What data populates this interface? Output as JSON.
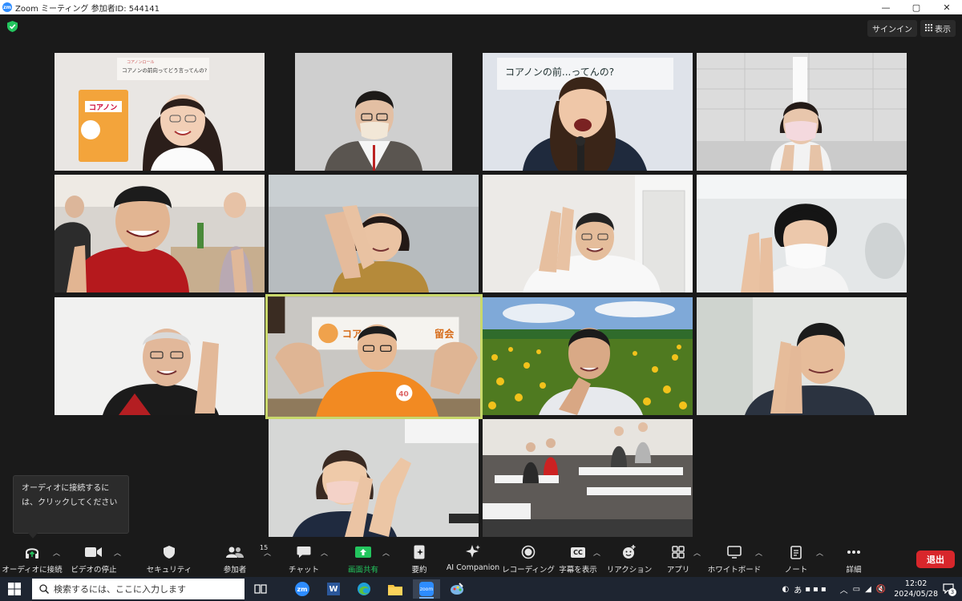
{
  "titlebar": {
    "app_badge": "zm",
    "title": "Zoom ミーティング 参加者ID: 544141",
    "minimize": "—",
    "maximize": "▢",
    "close": "✕"
  },
  "top_right": {
    "signin_label": "サインイン",
    "view_label": "表示"
  },
  "tiles": [
    {
      "id": "p1",
      "sign_text_1": "コアノンロール",
      "sign_text_2": "コアノンの前向ってどう言ってんの?",
      "product_label": "コアノン"
    },
    {
      "id": "p2"
    },
    {
      "id": "p3",
      "sign_text_1": "コアノンの前...ってんの?"
    },
    {
      "id": "p4"
    },
    {
      "id": "p5"
    },
    {
      "id": "p6"
    },
    {
      "id": "p7"
    },
    {
      "id": "p8"
    },
    {
      "id": "p9"
    },
    {
      "id": "p10",
      "sign_text_1": "コア",
      "sign_text_2": "留会",
      "badge": "40"
    },
    {
      "id": "p11"
    },
    {
      "id": "p12"
    },
    {
      "id": "p13"
    },
    {
      "id": "p14"
    }
  ],
  "tooltip": {
    "line1": "オーディオに接続するに",
    "line2": "は、クリックしてください"
  },
  "toolbar": {
    "audio": "オーディオに接続",
    "video": "ビデオの停止",
    "security": "セキュリティ",
    "participants": "参加者",
    "participants_count": "15",
    "chat": "チャット",
    "share": "画面共有",
    "summary": "要約",
    "ai": "AI Companion",
    "record": "レコーディング",
    "captions": "字幕を表示",
    "captions_badge": "CC",
    "reactions": "リアクション",
    "apps": "アプリ",
    "whiteboard": "ホワイトボード",
    "notes": "ノート",
    "more": "詳細",
    "leave": "退出",
    "share_color": "#23c55e",
    "leave_color": "#d8262b"
  },
  "taskbar": {
    "search_placeholder": "検索するには、ここに入力します",
    "time": "12:02",
    "date": "2024/05/28",
    "notification_count": "3",
    "ime": "あ"
  }
}
